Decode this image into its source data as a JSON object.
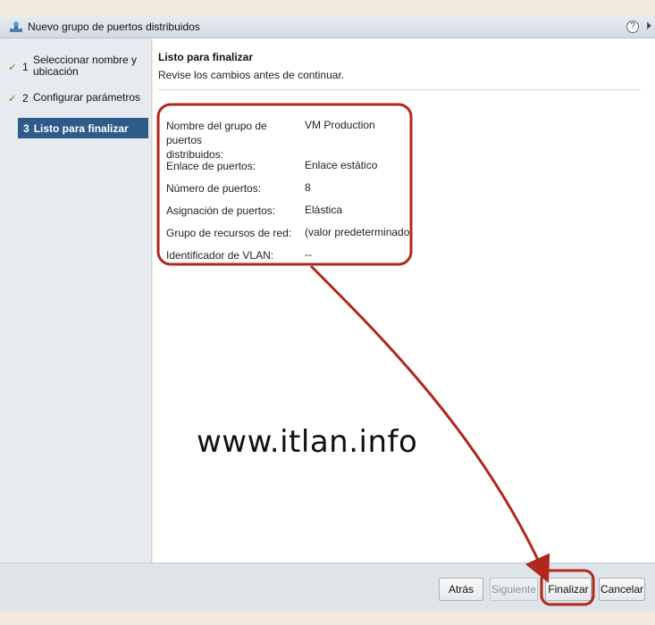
{
  "window": {
    "title": "Nuevo grupo de puertos distribuidos",
    "help_glyph": "?",
    "collapse_glyph": "⏵"
  },
  "wizard_steps": [
    {
      "number": "1",
      "label_line1": "Seleccionar nombre y",
      "label_line2": "ubicación",
      "status": "done"
    },
    {
      "number": "2",
      "label": "Configurar parámetros",
      "status": "done"
    },
    {
      "number": "3",
      "label": "Listo para finalizar",
      "status": "active"
    }
  ],
  "check_glyph": "✓",
  "content": {
    "title": "Listo para finalizar",
    "subtitle": "Revise los cambios antes de continuar.",
    "summary": [
      {
        "key_line1": "Nombre del grupo de puertos",
        "key_line2": "distribuidos:",
        "value": "VM Production"
      },
      {
        "key": "Enlace de puertos:",
        "value": "Enlace estático"
      },
      {
        "key": "Número de puertos:",
        "value": "8"
      },
      {
        "key": "Asignación de puertos:",
        "value": "Elástica"
      },
      {
        "key": "Grupo de recursos de red:",
        "value": "(valor predeterminado)"
      },
      {
        "key": "Identificador de VLAN:",
        "value": "--"
      }
    ]
  },
  "watermark": "www.itlan.info",
  "footer": {
    "back": "Atrás",
    "next": "Siguiente",
    "finish": "Finalizar",
    "cancel": "Cancelar"
  },
  "colors": {
    "annotation": "#b0281c",
    "active_step": "#2e5b8a",
    "check": "#3f9a2f"
  }
}
